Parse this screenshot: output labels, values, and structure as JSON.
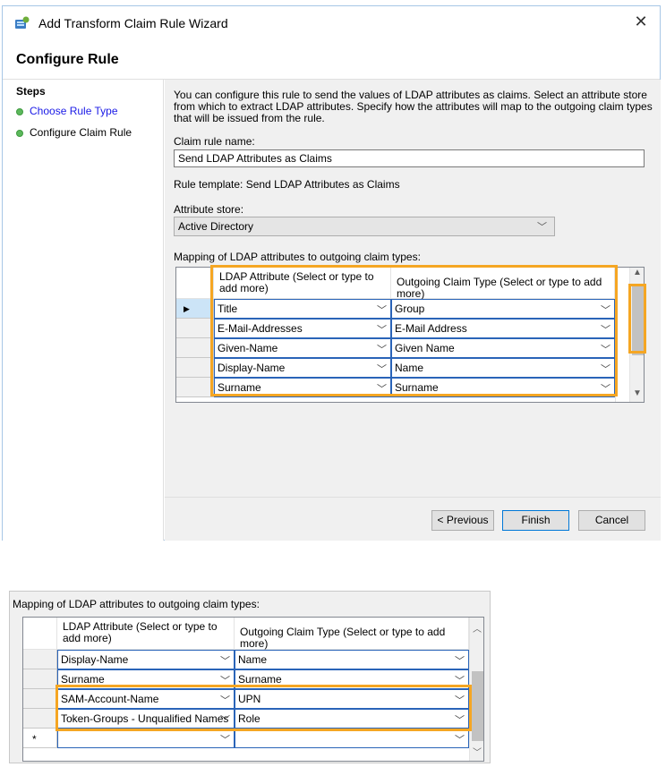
{
  "window": {
    "title": "Add Transform Claim Rule Wizard",
    "close_glyph": "✕",
    "page_heading": "Configure Rule"
  },
  "steps": {
    "title": "Steps",
    "items": [
      {
        "label": "Choose Rule Type",
        "status": "link"
      },
      {
        "label": "Configure Claim Rule",
        "status": "current"
      }
    ]
  },
  "content": {
    "description": "You can configure this rule to send the values of LDAP attributes as claims. Select an attribute store from which to extract LDAP attributes. Specify how the attributes will map to the outgoing claim types that will be issued from the rule.",
    "claim_rule_name_label": "Claim rule name:",
    "claim_rule_name_value": "Send LDAP Attributes as Claims",
    "rule_template": "Rule template: Send LDAP Attributes as Claims",
    "attribute_store_label": "Attribute store:",
    "attribute_store_value": "Active Directory",
    "mapping_label": "Mapping of LDAP attributes to outgoing claim types:"
  },
  "grid": {
    "col1_header": "LDAP Attribute (Select or type to add more)",
    "col2_header": "Outgoing Claim Type (Select or type to add more)",
    "rows": [
      {
        "ldap": "Title",
        "claim": "Group"
      },
      {
        "ldap": "E-Mail-Addresses",
        "claim": "E-Mail Address"
      },
      {
        "ldap": "Given-Name",
        "claim": "Given Name"
      },
      {
        "ldap": "Display-Name",
        "claim": "Name"
      },
      {
        "ldap": "Surname",
        "claim": "Surname"
      }
    ]
  },
  "footer": {
    "previous_label": "< Previous",
    "finish_label": "Finish",
    "cancel_label": "Cancel"
  },
  "zoom_panel": {
    "mapping_label": "Mapping of LDAP attributes to outgoing claim types:",
    "col1_header": "LDAP Attribute (Select or type to add more)",
    "col2_header": "Outgoing Claim Type (Select or type to add more)",
    "rows": [
      {
        "ldap": "Display-Name",
        "claim": "Name"
      },
      {
        "ldap": "Surname",
        "claim": "Surname"
      },
      {
        "ldap": "SAM-Account-Name",
        "claim": "UPN"
      },
      {
        "ldap": "Token-Groups - Unqualified Names",
        "claim": "Role"
      },
      {
        "ldap": "",
        "claim": ""
      }
    ],
    "new_row_marker": "*"
  },
  "colors": {
    "highlight": "#f5a623",
    "cell_border": "#2a64b8",
    "link": "#1a1ae6",
    "step_dot": "#5cb85c"
  }
}
